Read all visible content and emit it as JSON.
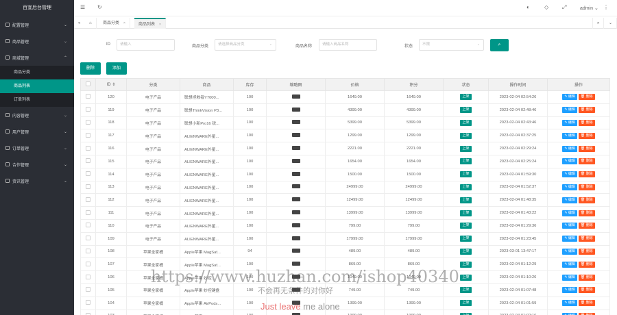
{
  "app": {
    "title": "百宜后台管理"
  },
  "sidebar": {
    "items": [
      {
        "label": "配置管理",
        "icon": "settings-icon"
      },
      {
        "label": "商品管理",
        "icon": "box-icon"
      },
      {
        "label": "商城管理",
        "icon": "store-icon",
        "expanded": true,
        "children": [
          {
            "label": "商品分类"
          },
          {
            "label": "商品列表",
            "active": true
          },
          {
            "label": "订单列表"
          }
        ]
      },
      {
        "label": "内容管理",
        "icon": "doc-icon"
      },
      {
        "label": "用户管理",
        "icon": "user-icon"
      },
      {
        "label": "订单管理",
        "icon": "order-icon"
      },
      {
        "label": "合作管理",
        "icon": "handshake-icon"
      },
      {
        "label": "资讯管理",
        "icon": "news-icon"
      }
    ]
  },
  "topbar": {
    "user": "admin",
    "icons": [
      "menu-icon",
      "refresh-icon",
      "theme-icon",
      "tag-icon",
      "fullscreen-icon"
    ]
  },
  "tabs": [
    {
      "label": "商品分类"
    },
    {
      "label": "商品列表",
      "active": true
    }
  ],
  "filters": {
    "id_label": "ID",
    "id_placeholder": "请输入",
    "category_label": "商品分类",
    "category_placeholder": "请选择商品分类",
    "name_label": "商品名称",
    "name_placeholder": "请输入商品名称",
    "status_label": "状态",
    "status_placeholder": "不限"
  },
  "actions": {
    "delete": "删除",
    "add": "添加"
  },
  "table": {
    "headers": [
      "ID",
      "分类",
      "商品",
      "库存",
      "缩略图",
      "价格",
      "积分",
      "状态",
      "操作时间",
      "操作"
    ],
    "status_label": "上架",
    "edit_label": "编辑",
    "delete_label": "删除",
    "rows": [
      {
        "id": "120",
        "cat": "电子产品",
        "name": "联想拯救者Y7000...",
        "stock": "100",
        "price": "1649.00",
        "points": "1649.00",
        "time": "2023-02-04 02:54:26"
      },
      {
        "id": "119",
        "cat": "电子产品",
        "name": "联想ThinkVision P3...",
        "stock": "100",
        "price": "4399.00",
        "points": "4399.00",
        "time": "2023-02-04 02:48:46"
      },
      {
        "id": "118",
        "cat": "电子产品",
        "name": "联想小新Pro16 锐...",
        "stock": "100",
        "price": "5399.00",
        "points": "5399.00",
        "time": "2023-02-04 02:43:46"
      },
      {
        "id": "117",
        "cat": "电子产品",
        "name": "ALIENWARE外星...",
        "stock": "100",
        "price": "1299.00",
        "points": "1299.00",
        "time": "2023-02-04 02:37:25"
      },
      {
        "id": "116",
        "cat": "电子产品",
        "name": "ALIENWARE外星...",
        "stock": "100",
        "price": "2221.00",
        "points": "2221.00",
        "time": "2023-02-04 02:29:24"
      },
      {
        "id": "115",
        "cat": "电子产品",
        "name": "ALIENWARE外星...",
        "stock": "100",
        "price": "1654.00",
        "points": "1654.00",
        "time": "2023-02-04 02:25:24"
      },
      {
        "id": "114",
        "cat": "电子产品",
        "name": "ALIENWARE外星...",
        "stock": "100",
        "price": "1500.00",
        "points": "1500.00",
        "time": "2023-02-04 01:59:30"
      },
      {
        "id": "113",
        "cat": "电子产品",
        "name": "ALIENWARE外星...",
        "stock": "100",
        "price": "24999.00",
        "points": "24999.00",
        "time": "2023-02-04 01:52:37"
      },
      {
        "id": "112",
        "cat": "电子产品",
        "name": "ALIENWARE外星...",
        "stock": "100",
        "price": "12499.00",
        "points": "12499.00",
        "time": "2023-02-04 01:48:35"
      },
      {
        "id": "111",
        "cat": "电子产品",
        "name": "ALIENWARE外星...",
        "stock": "100",
        "price": "13999.00",
        "points": "13999.00",
        "time": "2023-02-04 01:43:22"
      },
      {
        "id": "110",
        "cat": "电子产品",
        "name": "ALIENWARE外星...",
        "stock": "100",
        "price": "799.00",
        "points": "799.00",
        "time": "2023-02-04 01:29:36"
      },
      {
        "id": "109",
        "cat": "电子产品",
        "name": "ALIENWARE外星...",
        "stock": "100",
        "price": "17999.00",
        "points": "17999.00",
        "time": "2023-02-04 01:23:45"
      },
      {
        "id": "108",
        "cat": "苹果全家桶",
        "name": "Apple苹果 MagSaf...",
        "stock": "94",
        "price": "489.00",
        "points": "489.00",
        "time": "2023-03-01 13:47:17"
      },
      {
        "id": "107",
        "cat": "苹果全家桶",
        "name": "Apple苹果 MagSaf...",
        "stock": "100",
        "price": "869.00",
        "points": "869.00",
        "time": "2023-02-04 01:12:29"
      },
      {
        "id": "106",
        "cat": "苹果全家桶",
        "name": "Apple苹果 妙控...",
        "stock": "100",
        "price": "1049.00",
        "points": "1049.00",
        "time": "2023-02-04 01:10:26"
      },
      {
        "id": "105",
        "cat": "苹果全家桶",
        "name": "Apple苹果 妙控键盘",
        "stock": "100",
        "price": "749.00",
        "points": "749.00",
        "time": "2023-02-04 01:07:48"
      },
      {
        "id": "104",
        "cat": "苹果全家桶",
        "name": "Apple苹果 AirPods...",
        "stock": "100",
        "price": "1399.00",
        "points": "1399.00",
        "time": "2023-02-04 01:01:59"
      },
      {
        "id": "103",
        "cat": "苹果全家桶",
        "name": "Apple苹果 AirPods...",
        "stock": "100",
        "price": "1999.00",
        "points": "1999.00",
        "time": "2023-02-04 01:02:16"
      }
    ]
  },
  "watermark": {
    "line1": "https://www.huzhan.com/ishop40340",
    "line2": "不会再无条件的对你好",
    "line3a": "Just leave",
    "line3b": "me alone"
  }
}
